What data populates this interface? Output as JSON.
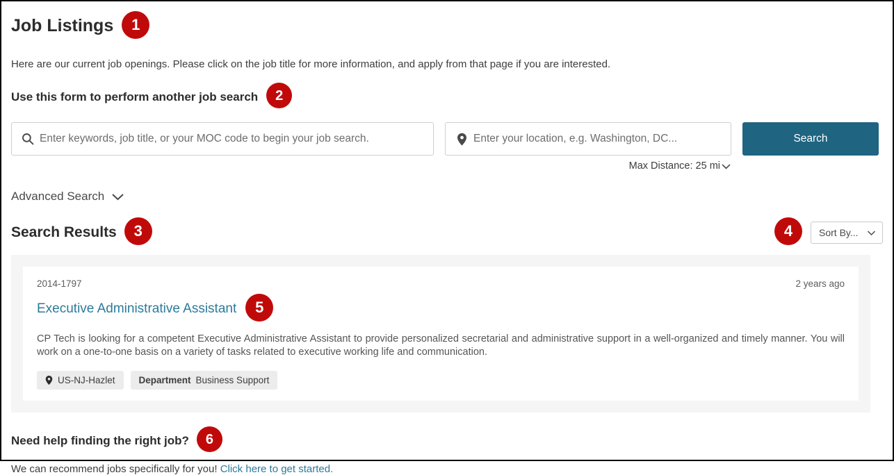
{
  "page": {
    "title": "Job Listings",
    "intro": "Here are our current job openings. Please click on the job title for more information, and apply from that page if you are interested."
  },
  "badges": {
    "one": "1",
    "two": "2",
    "three": "3",
    "four": "4",
    "five": "5",
    "six": "6",
    "color": "#C00A0A"
  },
  "search_form": {
    "heading": "Use this form to perform another job search",
    "keywords_placeholder": "Enter keywords, job title, or your MOC code to begin your job search.",
    "keywords_value": "",
    "location_placeholder": "Enter your location, e.g. Washington, DC...",
    "location_value": "",
    "max_distance_label": "Max Distance: 25 mi",
    "search_button": "Search",
    "search_button_color": "#1F6581",
    "advanced_search": "Advanced Search"
  },
  "results": {
    "title": "Search Results",
    "sort_label": "Sort By...",
    "jobs": [
      {
        "req_id": "2014-1797",
        "posted": "2 years ago",
        "title": "Executive Administrative Assistant",
        "title_color": "#2B7A9B",
        "description": "CP Tech is looking for a competent Executive Administrative Assistant to provide personalized secretarial and administrative support in a well-organized and timely manner. You will work on a one-to-one basis on a variety of tasks related to executive working life and communication.",
        "location_tag": "US-NJ-Hazlet",
        "department_label": "Department",
        "department_value": "Business Support"
      }
    ]
  },
  "help": {
    "title": "Need help finding the right job?",
    "text": "We can recommend jobs specifically for you!",
    "link": "Click here to get started."
  }
}
